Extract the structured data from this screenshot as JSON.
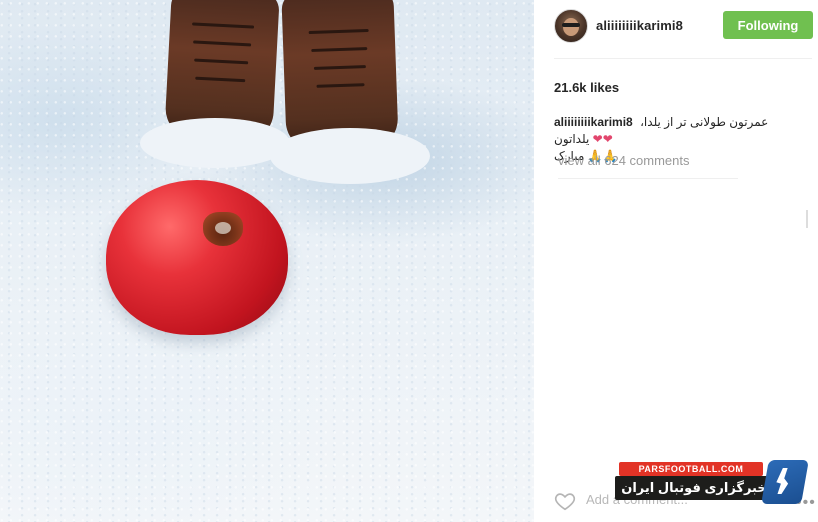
{
  "post": {
    "username": "aliiiiiiiikarimi8",
    "follow_label": "Following",
    "likes": "21.6k likes",
    "caption_user": "aliiiiiiiikarimi8",
    "caption_text": "عمرتون طولانی تر از یلدا، یلداتون",
    "caption_line2": "🙏🙏 مبارک",
    "view_all": "view all 624 comments",
    "add_comment_placeholder": "Add a comment...",
    "more_label": "•••"
  },
  "watermark": {
    "site": "PARSFOOTBALL.COM",
    "name": "خبرگزاری فوتبال ایران"
  },
  "colors": {
    "follow_green": "#70c050",
    "heart_pink": "#e2466d",
    "watermark_red": "#e23326"
  },
  "icons": {
    "like": "heart-outline-icon",
    "more": "ellipsis-icon"
  }
}
